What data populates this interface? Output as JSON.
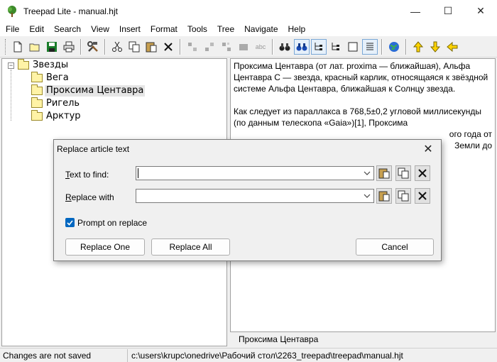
{
  "window": {
    "title": "Treepad Lite - manual.hjt",
    "minimize_glyph": "—",
    "maximize_glyph": "☐",
    "close_glyph": "✕"
  },
  "menu": {
    "items": [
      "File",
      "Edit",
      "Search",
      "View",
      "Insert",
      "Format",
      "Tools",
      "Tree",
      "Navigate",
      "Help"
    ]
  },
  "toolbar": {
    "icons": [
      "new-file-icon",
      "open-folder-icon",
      "save-icon",
      "print-icon",
      "tools-icon",
      "cut-icon",
      "copy-icon",
      "paste-icon",
      "delete-icon",
      "insert-node-icon",
      "add-child-icon",
      "move-node-icon",
      "node-icon",
      "spellcheck-icon",
      "find-icon",
      "replace-icon",
      "tree-view-icon",
      "tree-view-2-icon",
      "blank-icon",
      "text-view-icon",
      "globe-icon",
      "arrow-up-icon",
      "arrow-down-icon",
      "arrow-left-icon"
    ],
    "spellcheck_text": "abc"
  },
  "tree": {
    "root": "Звезды",
    "children": [
      "Вега",
      "Проксима Центавра",
      "Ригель",
      "Арктур"
    ],
    "selected": "Проксима Центавра",
    "expander_glyph": "−"
  },
  "article": {
    "paragraph1": "Проксима Центавра (от лат. proxima — ближайшая), Альфа Центавра C — звезда, красный карлик, относящаяся к звёздной системе Альфа Центавра, ближайшая к Солнцу звезда.",
    "paragraph2": "Как следует из параллакса в 768,5±0,2 угловой миллисекунды (по данным телескопа «Gaia»)[1], Проксима",
    "para2_tail1": "ого года от",
    "para2_tail2": "Земли до",
    "caption": "Проксима Центавра"
  },
  "status": {
    "left": "Changes are not saved",
    "path": "c:\\users\\krupc\\onedrive\\Рабочий стол\\2263_treepad\\treepad\\manual.hjt"
  },
  "dialog": {
    "title": "Replace article text",
    "find_label_accel": "T",
    "find_label_rest": "ext to find:",
    "replace_label_accel": "R",
    "replace_label_rest": "eplace with",
    "find_value": "",
    "replace_value": "",
    "prompt_label": "Prompt on replace",
    "prompt_checked": true,
    "replace_one": "Replace One",
    "replace_all": "Replace All",
    "cancel": "Cancel",
    "close_glyph": "✕"
  },
  "colors": {
    "accent": "#0067c0",
    "selection": "#e5e5e5",
    "folder_fill": "#fff3a6"
  }
}
